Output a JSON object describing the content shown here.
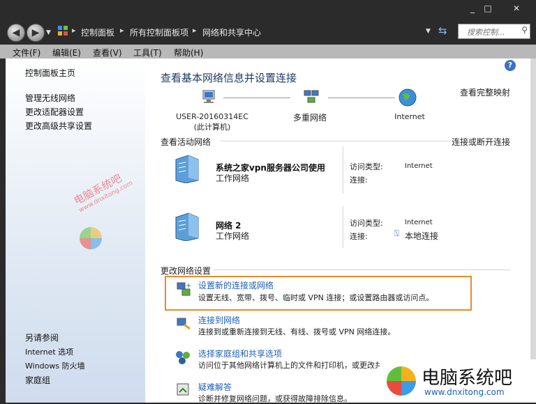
{
  "window": {
    "min": "_",
    "max": "□",
    "close": "✕"
  },
  "address": {
    "crumbs": [
      "控制面板",
      "所有控制面板项",
      "网络和共享中心"
    ],
    "search_placeholder": "搜索控制... "
  },
  "menu": [
    "文件(F)",
    "编辑(E)",
    "查看(V)",
    "工具(T)",
    "帮助(H)"
  ],
  "sidebar": {
    "home": "控制面板主页",
    "links": [
      "管理无线网络",
      "更改适配器设置",
      "更改高级共享设置"
    ],
    "see_also_title": "另请参阅",
    "see_also": [
      "Internet 选项",
      "Windows 防火墙",
      "家庭组"
    ]
  },
  "main": {
    "title": "查看基本网络信息并设置连接",
    "map": {
      "computer": "USER-20160314EC",
      "computer_sub": "(此计算机)",
      "middle": "多重网络",
      "right": "Internet",
      "view_full": "查看完整映射"
    },
    "active": {
      "title": "查看活动网络",
      "connect_link": "连接或断开连接",
      "networks": [
        {
          "name": "系统之家vpn服务器公司使用",
          "type": "工作网络",
          "access_label": "访问类型:",
          "access_value": "Internet",
          "conn_label": "连接:",
          "conn_value": ""
        },
        {
          "name": "网络  2",
          "type": "工作网络",
          "access_label": "访问类型:",
          "access_value": "Internet",
          "conn_label": "连接:",
          "conn_value": "本地连接"
        }
      ]
    },
    "change": {
      "title": "更改网络设置",
      "tasks": [
        {
          "title": "设置新的连接或网络",
          "desc": "设置无线、宽带、拨号、临时或 VPN 连接；或设置路由器或访问点。"
        },
        {
          "title": "连接到网络",
          "desc": "连接到或重新连接到无线、有线、拨号或 VPN 网络连接。"
        },
        {
          "title": "选择家庭组和共享选项",
          "desc": "访问位于其他网络计算机上的文件和打印机，或更改共享设置。"
        },
        {
          "title": "疑难解答",
          "desc": "诊断并修复网络问题，或获得故障排除信息。"
        }
      ]
    }
  },
  "watermark": {
    "text": "电脑系统吧",
    "url": "www.dnxitong.com"
  },
  "colors": {
    "link": "#1f5fb8",
    "highlight": "#e88a2a",
    "title": "#1e3b62"
  }
}
